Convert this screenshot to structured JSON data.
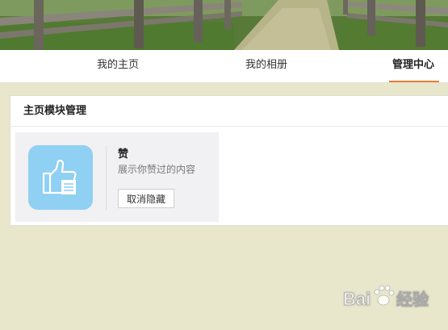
{
  "nav": {
    "tabs": [
      {
        "label": "我的主页",
        "active": false
      },
      {
        "label": "我的相册",
        "active": false
      },
      {
        "label": "管理中心",
        "active": true
      }
    ],
    "accent_color": "#f07b32"
  },
  "panel": {
    "title": "主页模块管理",
    "module": {
      "icon": "thumbs-up-icon",
      "icon_bg": "#8fd0f3",
      "name": "赞",
      "description": "展示你赞过的内容",
      "button_label": "取消隐藏"
    }
  },
  "watermark": {
    "text": "Bai 经验",
    "icon": "paw-icon"
  }
}
